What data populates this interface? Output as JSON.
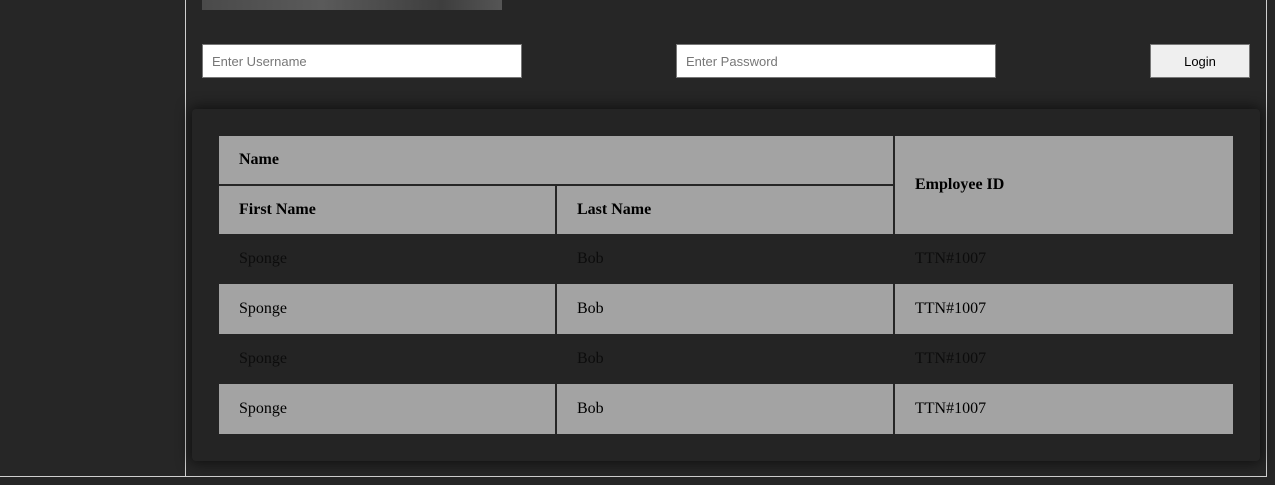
{
  "login": {
    "username_placeholder": "Enter Username",
    "password_placeholder": "Enter Password",
    "login_label": "Login"
  },
  "table": {
    "group_header": "Name",
    "columns": {
      "first_name": "First Name",
      "last_name": "Last Name",
      "employee_id": "Employee ID"
    },
    "rows": [
      {
        "first": "Sponge",
        "last": "Bob",
        "id": "TTN#1007"
      },
      {
        "first": "Sponge",
        "last": "Bob",
        "id": "TTN#1007"
      },
      {
        "first": "Sponge",
        "last": "Bob",
        "id": "TTN#1007"
      },
      {
        "first": "Sponge",
        "last": "Bob",
        "id": "TTN#1007"
      }
    ]
  },
  "colors": {
    "background": "#262626",
    "table_header": "#a3a3a3",
    "row_alt": "#a3a3a3"
  }
}
